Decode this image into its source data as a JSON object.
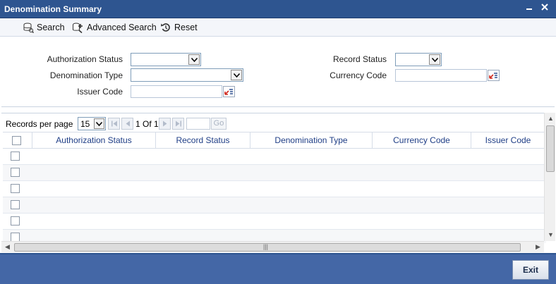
{
  "window": {
    "title": "Denomination Summary",
    "minimize": "▁",
    "close": "✕"
  },
  "toolbar": {
    "search": "Search",
    "advanced_search": "Advanced Search",
    "reset": "Reset"
  },
  "search_form": {
    "authorization_status": {
      "label": "Authorization Status",
      "value": ""
    },
    "record_status": {
      "label": "Record Status",
      "value": ""
    },
    "denomination_type": {
      "label": "Denomination Type",
      "value": ""
    },
    "currency_code": {
      "label": "Currency Code",
      "value": ""
    },
    "issuer_code": {
      "label": "Issuer Code",
      "value": ""
    }
  },
  "pager": {
    "records_per_page_label": "Records per page",
    "records_per_page": "15",
    "page_info": "1 Of 1",
    "go_label": "Go"
  },
  "table": {
    "columns": [
      "Authorization Status",
      "Record Status",
      "Denomination Type",
      "Currency Code",
      "Issuer Code"
    ],
    "empty_rows": 6
  },
  "footer": {
    "exit": "Exit"
  },
  "colors": {
    "title_bar": "#2e5590",
    "footer": "#4467a6",
    "header_text": "#1f3e86"
  }
}
